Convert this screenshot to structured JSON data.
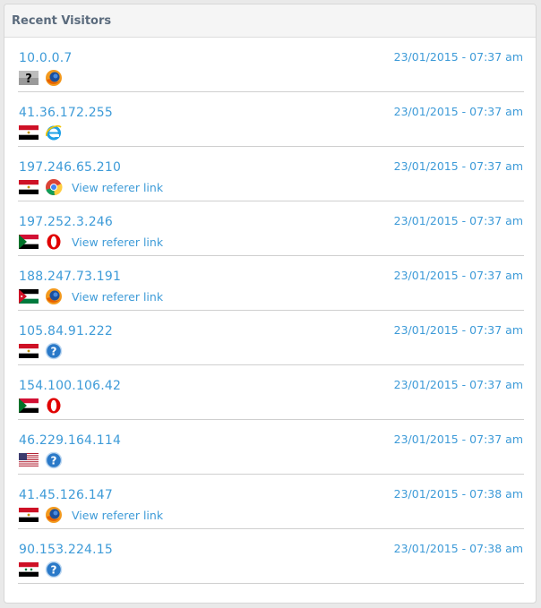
{
  "panel": {
    "title": "Recent Visitors"
  },
  "visitors": [
    {
      "ip": "10.0.0.7",
      "time": "23/01/2015 - 07:37 am",
      "flag": "unknown-flag-icon",
      "browser": "firefox-icon",
      "referer": ""
    },
    {
      "ip": "41.36.172.255",
      "time": "23/01/2015 - 07:37 am",
      "flag": "egypt-flag-icon",
      "browser": "internet-explorer-icon",
      "referer": ""
    },
    {
      "ip": "197.246.65.210",
      "time": "23/01/2015 - 07:37 am",
      "flag": "egypt-flag-icon",
      "browser": "chrome-icon",
      "referer": "View referer link"
    },
    {
      "ip": "197.252.3.246",
      "time": "23/01/2015 - 07:37 am",
      "flag": "sudan-flag-icon",
      "browser": "opera-icon",
      "referer": "View referer link"
    },
    {
      "ip": "188.247.73.191",
      "time": "23/01/2015 - 07:37 am",
      "flag": "jordan-flag-icon",
      "browser": "firefox-icon",
      "referer": "View referer link"
    },
    {
      "ip": "105.84.91.222",
      "time": "23/01/2015 - 07:37 am",
      "flag": "egypt-flag-icon",
      "browser": "unknown-browser-icon",
      "referer": ""
    },
    {
      "ip": "154.100.106.42",
      "time": "23/01/2015 - 07:37 am",
      "flag": "sudan-flag-icon",
      "browser": "opera-icon",
      "referer": ""
    },
    {
      "ip": "46.229.164.114",
      "time": "23/01/2015 - 07:37 am",
      "flag": "usa-flag-icon",
      "browser": "unknown-browser-icon",
      "referer": ""
    },
    {
      "ip": "41.45.126.147",
      "time": "23/01/2015 - 07:38 am",
      "flag": "egypt-flag-icon",
      "browser": "firefox-icon",
      "referer": "View referer link"
    },
    {
      "ip": "90.153.224.15",
      "time": "23/01/2015 - 07:38 am",
      "flag": "syria-flag-icon",
      "browser": "unknown-browser-icon",
      "referer": ""
    }
  ],
  "colors": {
    "link": "#3e9bd8",
    "header_text": "#5b6b7d",
    "divider": "#cfcfcf"
  }
}
